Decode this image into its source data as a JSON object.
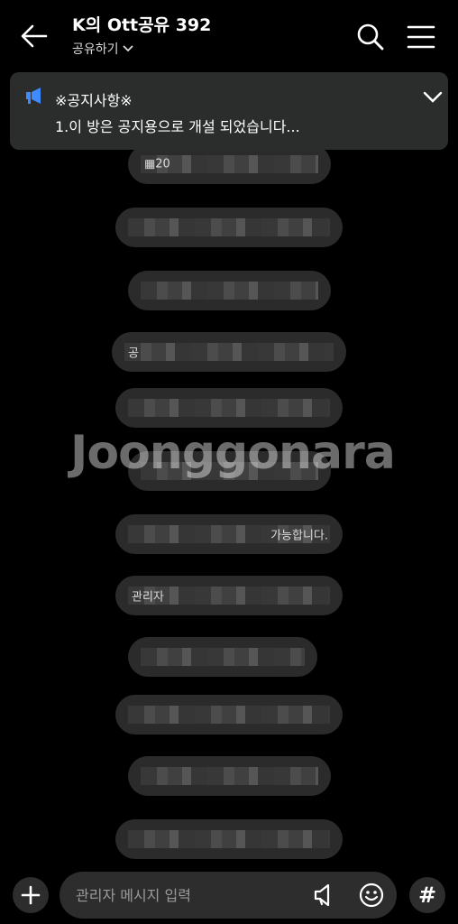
{
  "header": {
    "title": "K의 Ott공유 392",
    "subtitle": "공유하기",
    "back_icon": "arrow-left-icon",
    "search_icon": "search-icon",
    "menu_icon": "hamburger-menu-icon"
  },
  "notice": {
    "label": "※공지사항※",
    "text": "1.이 방은 공지용으로 개설 되었습니다...",
    "icon": "megaphone-icon",
    "accent": "#3d8bff"
  },
  "messages": [
    {
      "text": "▦20"
    },
    {
      "text": ""
    },
    {
      "text": ""
    },
    {
      "text": "공"
    },
    {
      "text": ""
    },
    {
      "text": ""
    },
    {
      "text": "가능합니다."
    },
    {
      "text": "관리자"
    },
    {
      "text": ""
    },
    {
      "text": ""
    },
    {
      "text": ""
    },
    {
      "text": ""
    }
  ],
  "watermark": "Joonggonara",
  "composer": {
    "placeholder": "관리자 메시지 입력",
    "plus_icon": "plus-icon",
    "speaker_icon": "speaker-icon",
    "emoji_icon": "emoji-icon",
    "hash_label": "#"
  }
}
